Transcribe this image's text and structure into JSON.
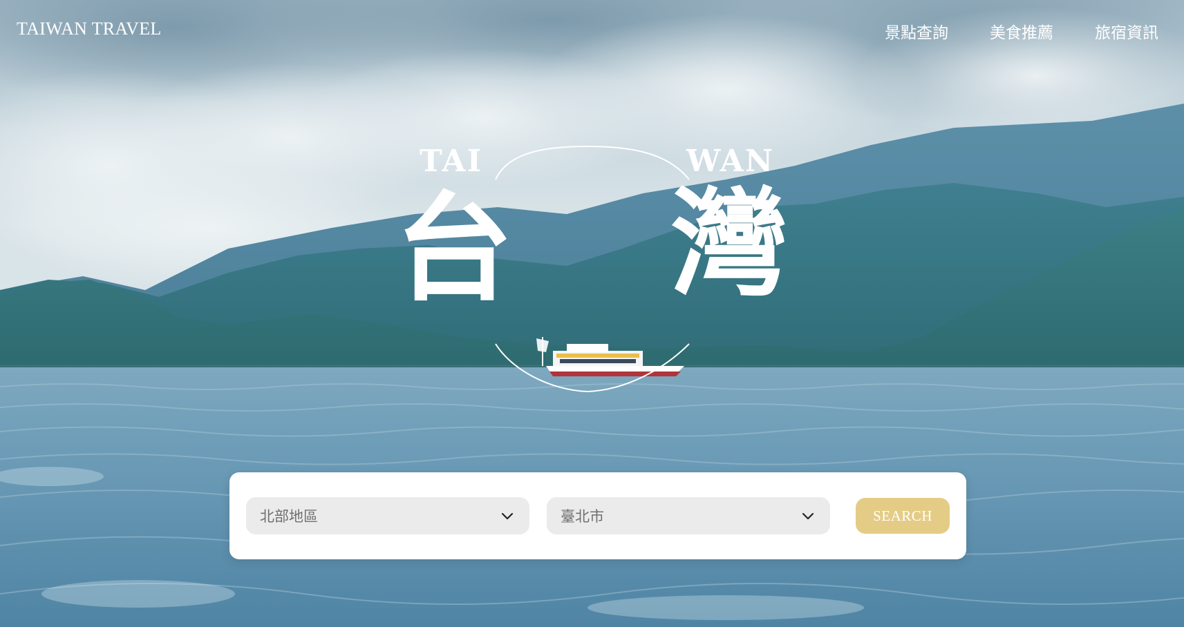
{
  "header": {
    "logo": "TAIWAN TRAVEL",
    "nav": [
      {
        "label": "景點查詢"
      },
      {
        "label": "美食推薦"
      },
      {
        "label": "旅宿資訊"
      }
    ]
  },
  "hero": {
    "en_left": "TAI",
    "en_right": "WAN",
    "zh_left": "台",
    "zh_right": "灣"
  },
  "search": {
    "region": {
      "value": "北部地區",
      "icon": "chevron-down-icon"
    },
    "city": {
      "value": "臺北市",
      "icon": "chevron-down-icon"
    },
    "button_label": "SEARCH"
  },
  "colors": {
    "accent": "#e5cc86",
    "panel": "#ffffff",
    "select_bg": "#ebebeb",
    "text_muted": "#6f6f6f"
  }
}
